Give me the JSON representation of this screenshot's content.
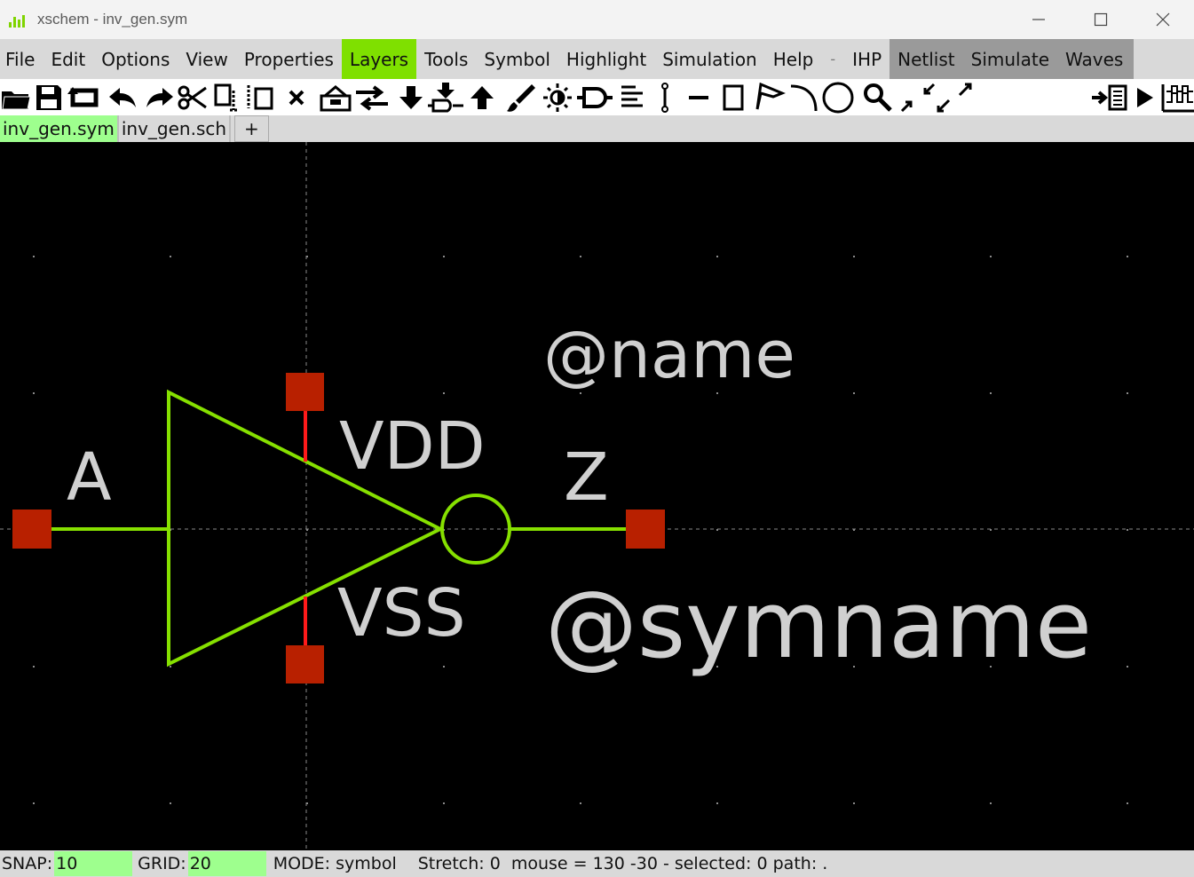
{
  "window": {
    "title": "xschem - inv_gen.sym",
    "app_icon": "xschem-logo-icon",
    "controls": [
      "minimize-icon",
      "maximize-icon",
      "close-icon"
    ]
  },
  "menubar": {
    "items": [
      "File",
      "Edit",
      "Options",
      "View",
      "Properties",
      "Layers",
      "Tools",
      "Symbol",
      "Highlight",
      "Simulation",
      "Help",
      "-",
      "IHP",
      "Netlist",
      "Simulate",
      "Waves"
    ],
    "active": "Layers",
    "accent": "#7fe000",
    "shaded": [
      "Netlist",
      "Simulate",
      "Waves"
    ]
  },
  "toolbar": {
    "icons": [
      "open-folder-icon",
      "save-icon",
      "reload-icon",
      "undo-icon",
      "redo-icon",
      "cut-icon",
      "copy-icon",
      "move-icon",
      "delete-icon",
      "push-icon",
      "swap-icon",
      "descend-icon",
      "descend-symbol-icon",
      "ascend-icon",
      "paint-brush-icon",
      "highlight-icon",
      "insert-pin-icon",
      "align-icon",
      "wire-icon",
      "line-icon",
      "rect-icon",
      "polygon-icon",
      "arc-icon",
      "circle-icon",
      "zoom-icon",
      "zoom-in-icon",
      "zoom-full-icon",
      "netlist-icon",
      "simulate-icon",
      "waves-icon"
    ]
  },
  "tabs": {
    "items": [
      "inv_gen.sym",
      "inv_gen.sch",
      "+"
    ],
    "active": "inv_gen.sym"
  },
  "schematic": {
    "symbol": "inverter",
    "pins": {
      "input": "A",
      "output": "Z",
      "supply": "VDD",
      "ground": "VSS"
    },
    "attributes": {
      "name": "@name",
      "symname": "@symname"
    },
    "colors": {
      "body": "#86e000",
      "pin_wire": "#ff1a1a",
      "pin_box": "#b82000",
      "text": "#d0d0d0",
      "background": "#000000",
      "grid": "#8a8a8a"
    }
  },
  "statusbar": {
    "snap_label": "SNAP:",
    "snap_value": "10",
    "grid_label": "GRID:",
    "grid_value": "20",
    "mode": "MODE:  symbol",
    "stretch": "Stretch: 0",
    "mouse": "mouse = 130 -30 - selected: 0 path: ."
  }
}
